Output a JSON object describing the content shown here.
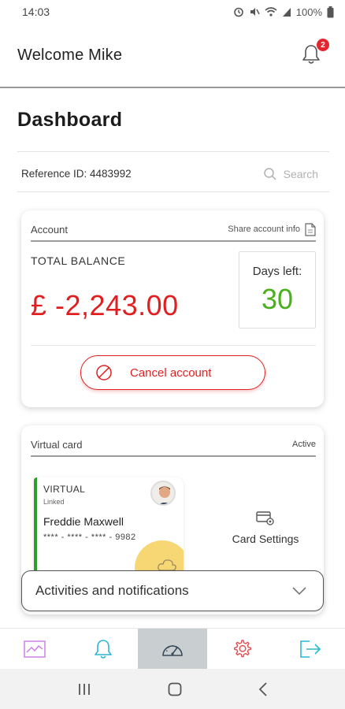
{
  "status_bar": {
    "time": "14:03",
    "battery": "100%",
    "icons": [
      "alarm-icon",
      "mute-icon",
      "wifi-icon",
      "signal-icon",
      "battery-icon"
    ]
  },
  "header": {
    "welcome": "Welcome Mike",
    "notification_count": "2"
  },
  "page": {
    "title": "Dashboard",
    "reference_id": "Reference ID: 4483992",
    "search_placeholder": "Search"
  },
  "account": {
    "section_label": "Account",
    "share_label": "Share account info",
    "total_label": "TOTAL BALANCE",
    "balance": "£ -2,243.00",
    "days_left_label": "Days left:",
    "days_left_value": "30",
    "cancel_label": "Cancel account"
  },
  "virtual_card": {
    "section_label": "Virtual card",
    "status": "Active",
    "card_type": "VIRTUAL",
    "linked": "Linked",
    "holder": "Freddie Maxwell",
    "number": "**** - **** - **** - 9982",
    "settings_label": "Card Settings"
  },
  "activities": {
    "label": "Activities and notifications"
  },
  "bottom_nav": {
    "items": [
      "chart-icon",
      "bell-icon",
      "dashboard-gauge-icon",
      "settings-gear-icon",
      "logout-icon"
    ],
    "active_index": 2
  },
  "colors": {
    "balance_red": "#e02020",
    "days_green": "#4caf1e",
    "card_stripe_green": "#2e9e2e",
    "nav_active_bg": "#c9ced1"
  }
}
